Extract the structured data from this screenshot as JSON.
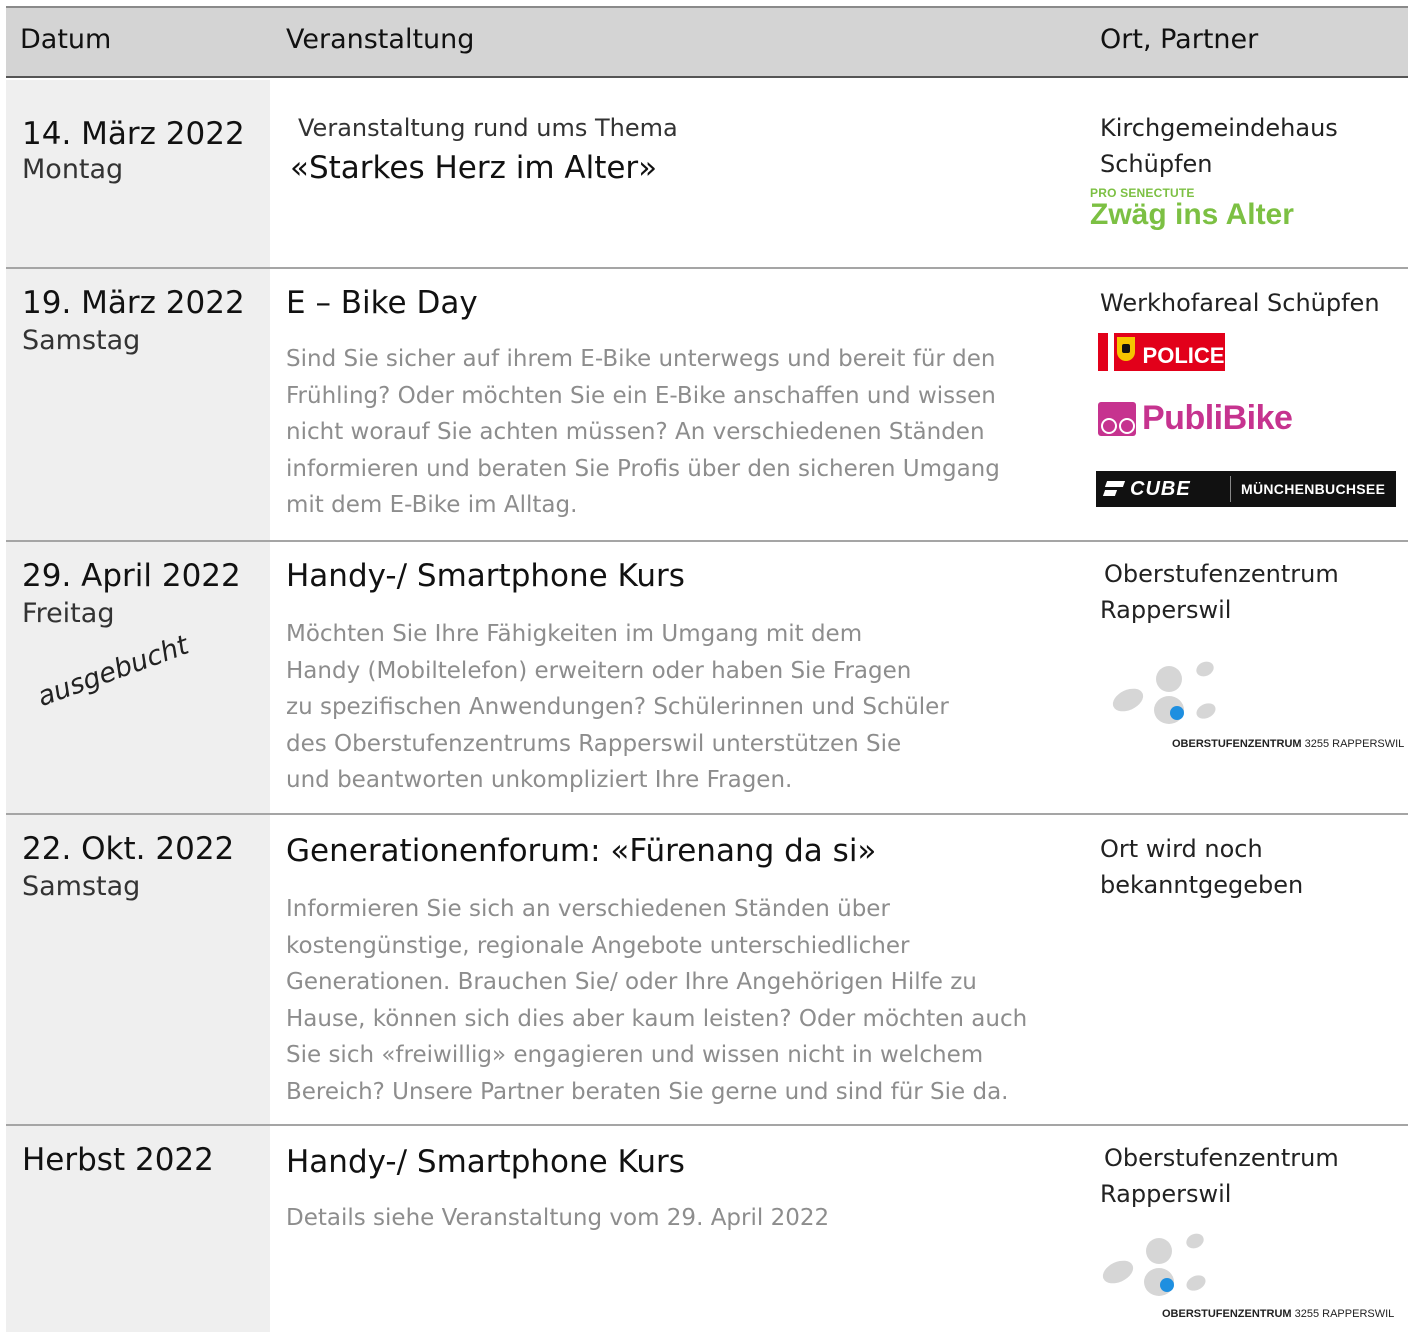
{
  "header": {
    "date_label": "Datum",
    "event_label": "Veranstaltung",
    "place_label": "Ort, Partner"
  },
  "rows": [
    {
      "date": "14. März 2022",
      "weekday": "Montag",
      "title_small": "Veranstaltung rund ums Thema",
      "title": "«Starkes Herz im Alter»",
      "description": [],
      "place": [
        "Kirchgemeindehaus",
        "Schüpfen"
      ],
      "logos": {
        "prosenectute_pre": "PRO SENECTUTE",
        "prosenectute_main": "Zwäg ins Alter"
      }
    },
    {
      "date": "19. März 2022",
      "weekday": "Samstag",
      "title": "E – Bike Day",
      "description": [
        "Sind Sie sicher auf ihrem E-Bike unterwegs und bereit für den",
        "Frühling? Oder möchten Sie ein E-Bike anschaffen und wissen",
        "nicht worauf Sie achten müssen? An verschiedenen Ständen",
        "informieren und beraten Sie Profis über den sicheren Umgang",
        "mit dem E-Bike im Alltag."
      ],
      "place": [
        "Werkhofareal Schüpfen"
      ],
      "logos": {
        "police": "POLICE",
        "publibike": "PubliBike",
        "cube": "CUBE",
        "cube_city": "MÜNCHENBUCHSEE"
      }
    },
    {
      "date": "29. April 2022",
      "weekday": "Freitag",
      "status": "ausgebucht",
      "title": "Handy-/ Smartphone Kurs",
      "description": [
        "Möchten Sie Ihre Fähigkeiten im Umgang mit dem",
        "Handy (Mobiltelefon) erweitern oder haben Sie Fragen",
        "zu spezifischen Anwendungen? Schülerinnen und Schüler",
        "des Oberstufenzentrums Rapperswil unterstützen Sie",
        "und beantworten unkompliziert Ihre Fragen."
      ],
      "place": [
        "Oberstufenzentrum",
        "Rapperswil"
      ],
      "logos": {
        "osz_bold": "OBERSTUFENZENTRUM",
        "osz_rest": "3255 RAPPERSWIL"
      }
    },
    {
      "date": "22. Okt. 2022",
      "weekday": "Samstag",
      "title": "Generationenforum: «Fürenang da si»",
      "description": [
        "Informieren Sie sich an verschiedenen Ständen über",
        "kostengünstige, regionale Angebote unterschiedlicher",
        "Generationen. Brauchen Sie/ oder Ihre Angehörigen Hilfe zu",
        "Hause, können sich dies aber kaum leisten? Oder möchten auch",
        "Sie sich «freiwillig» engagieren und wissen nicht in welchem",
        "Bereich? Unsere Partner beraten Sie gerne und sind für Sie da."
      ],
      "place": [
        "Ort wird noch",
        "bekanntgegeben"
      ]
    },
    {
      "date": "Herbst 2022",
      "weekday": "",
      "title": "Handy-/ Smartphone Kurs",
      "description": [
        "Details siehe Veranstaltung vom 29. April 2022"
      ],
      "place": [
        "Oberstufenzentrum",
        "Rapperswil"
      ],
      "logos": {
        "osz_bold": "OBERSTUFENZENTRUM",
        "osz_rest": "3255 RAPPERSWIL"
      }
    }
  ],
  "colors": {
    "header_bg": "#d4d4d4",
    "date_col_bg": "#efefef",
    "desc_text": "#8d8d8d",
    "prosenectute_green": "#7cc043",
    "police_red": "#e2001a",
    "publibike_magenta": "#c6338f",
    "osz_blue": "#1e8fe0"
  }
}
